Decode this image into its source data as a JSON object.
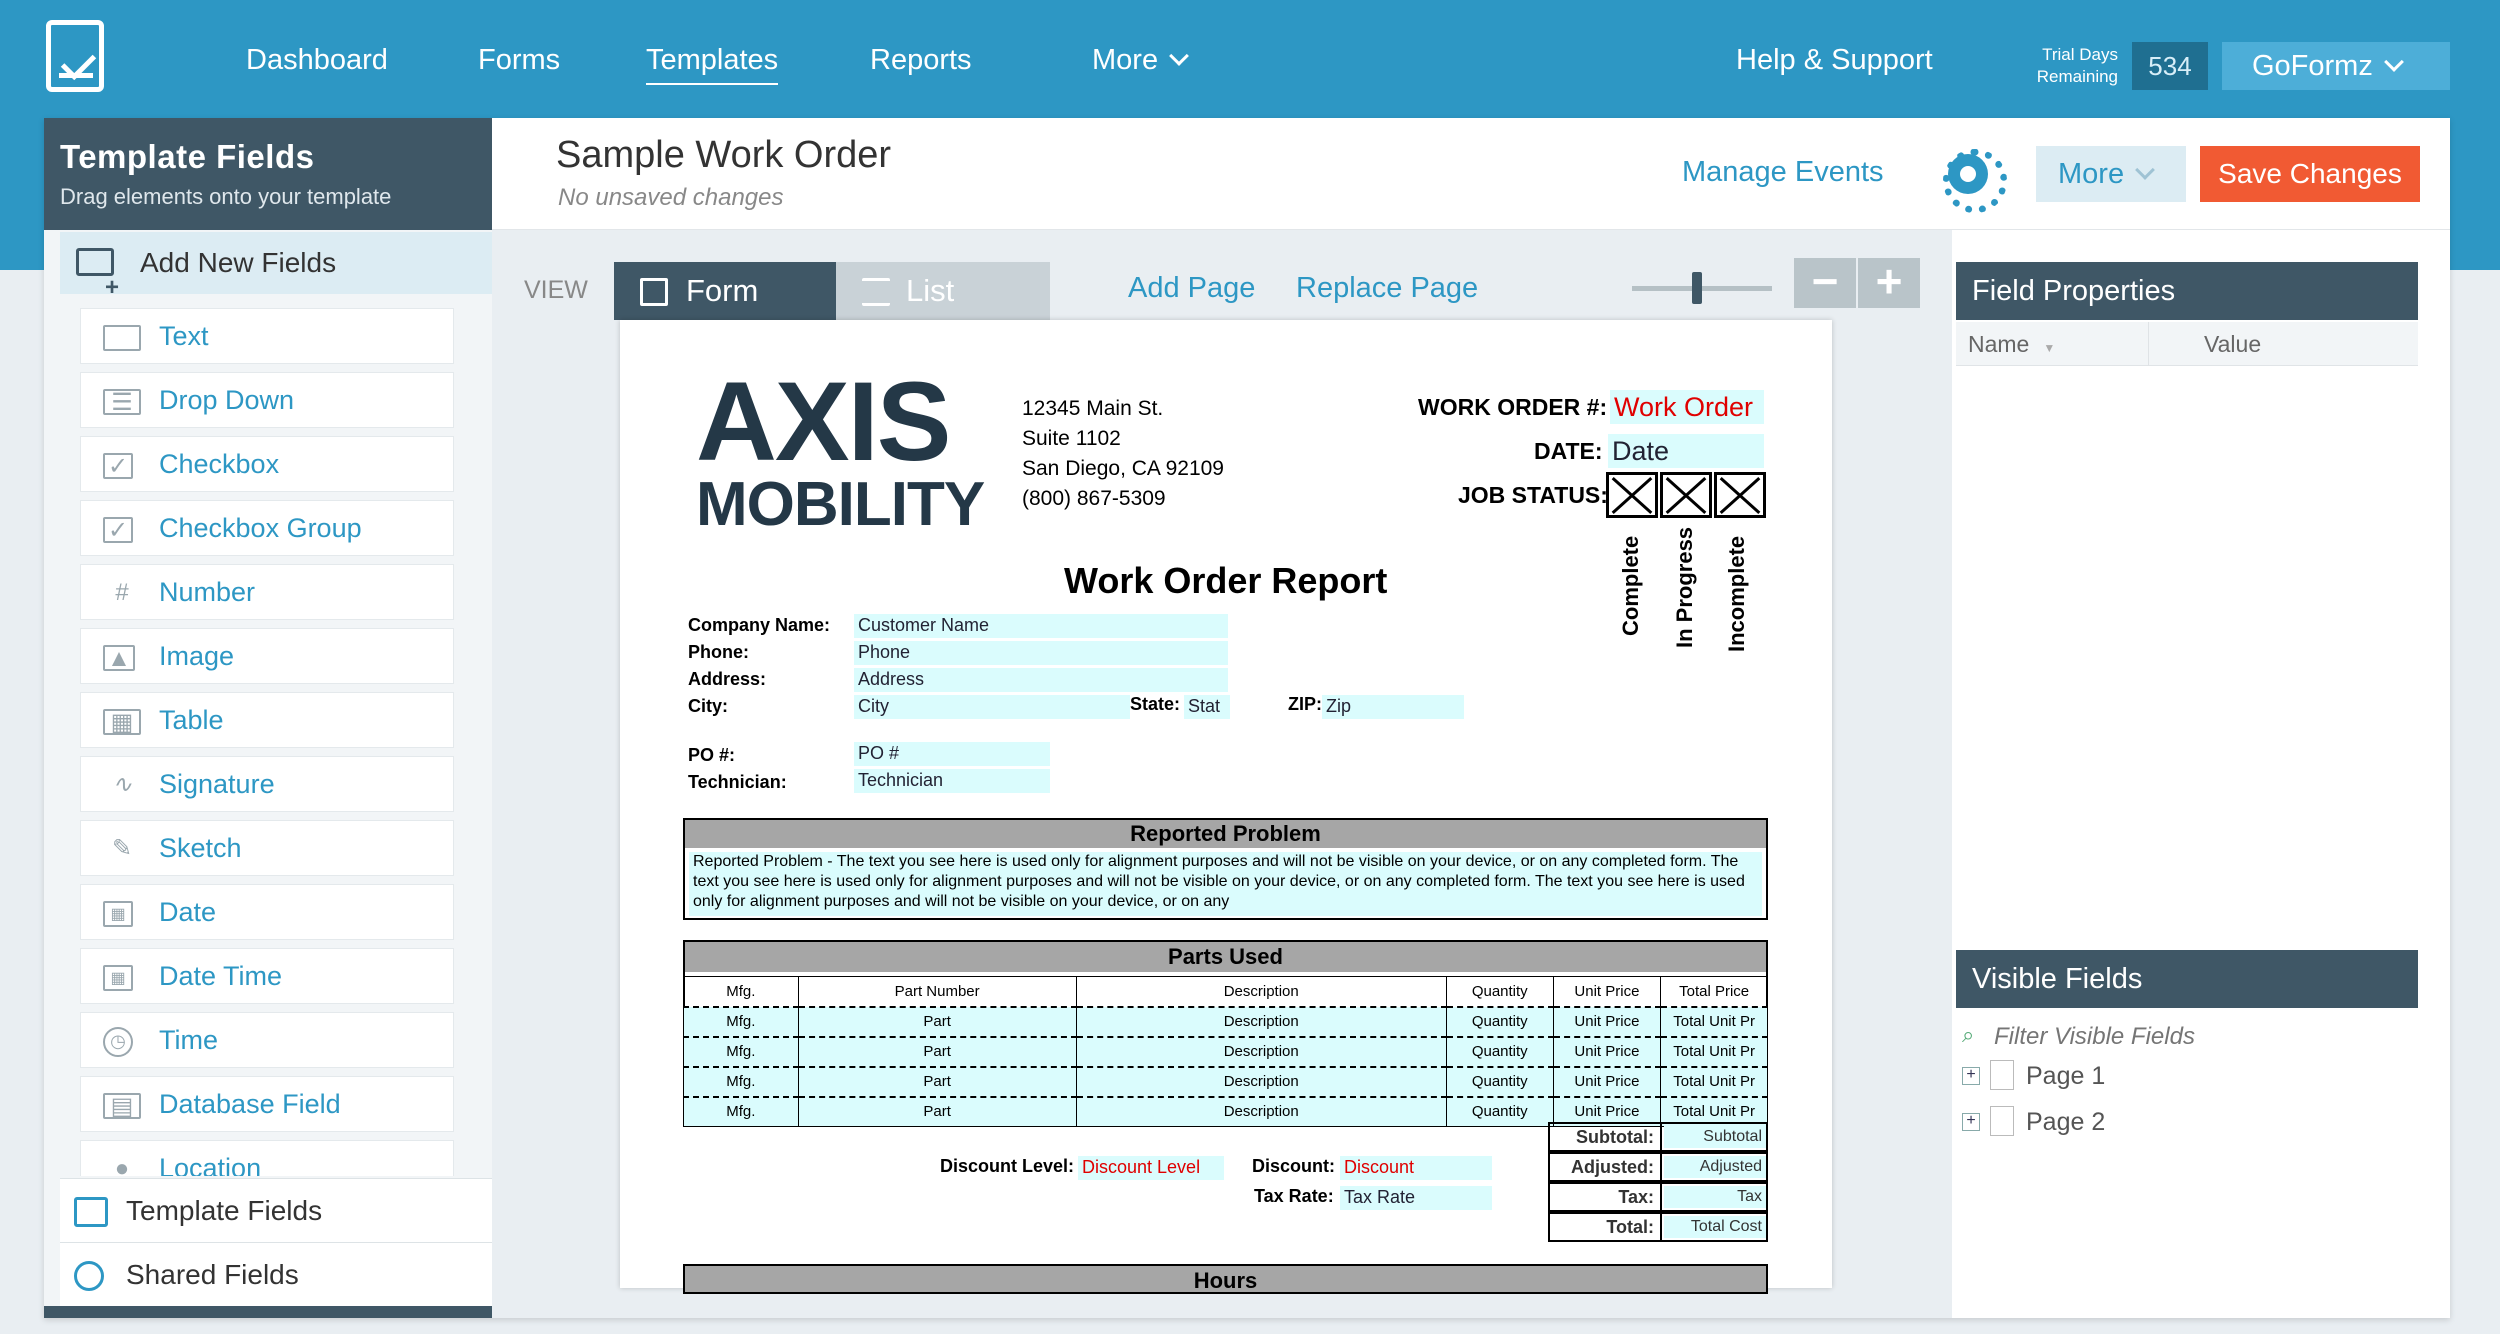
{
  "nav": {
    "dashboard": "Dashboard",
    "forms": "Forms",
    "templates": "Templates",
    "reports": "Reports",
    "more": "More",
    "help": "Help & Support",
    "trial_label_1": "Trial Days",
    "trial_label_2": "Remaining",
    "trial_days": "534",
    "account": "GoFormz"
  },
  "sidebar": {
    "title": "Template Fields",
    "subtitle": "Drag elements onto your template",
    "add_new": "Add New Fields",
    "items": [
      {
        "label": "Text",
        "icon": "text-field-icon"
      },
      {
        "label": "Drop Down",
        "icon": "dropdown-icon"
      },
      {
        "label": "Checkbox",
        "icon": "checkbox-icon"
      },
      {
        "label": "Checkbox Group",
        "icon": "checkbox-group-icon"
      },
      {
        "label": "Number",
        "icon": "hash-icon"
      },
      {
        "label": "Image",
        "icon": "image-icon"
      },
      {
        "label": "Table",
        "icon": "table-icon"
      },
      {
        "label": "Signature",
        "icon": "signature-icon"
      },
      {
        "label": "Sketch",
        "icon": "pencil-icon"
      },
      {
        "label": "Date",
        "icon": "calendar-icon"
      },
      {
        "label": "Date Time",
        "icon": "calendar-clock-icon"
      },
      {
        "label": "Time",
        "icon": "clock-icon"
      },
      {
        "label": "Database Field",
        "icon": "database-icon"
      },
      {
        "label": "Location",
        "icon": "location-pin-icon"
      }
    ],
    "template_fields": "Template Fields",
    "shared_fields": "Shared Fields"
  },
  "header": {
    "doc_title": "Sample Work Order",
    "doc_status": "No unsaved changes",
    "manage_events": "Manage Events",
    "more": "More",
    "save": "Save Changes"
  },
  "toolbar": {
    "view_label": "VIEW",
    "tab_form": "Form",
    "tab_list": "List",
    "add_page": "Add Page",
    "replace_page": "Replace Page",
    "zoom_out": "−",
    "zoom_in": "+"
  },
  "document": {
    "logo_axis": "AXIS",
    "logo_mobility": "MOBILITY",
    "address_1": "12345 Main St.",
    "address_2": "Suite 1102",
    "address_3": "San Diego, CA 92109",
    "phone": "(800) 867-5309",
    "work_order_label": "WORK ORDER #:",
    "work_order_value": "Work Order",
    "date_label": "DATE:",
    "date_value": "Date",
    "job_status_label": "JOB STATUS:",
    "status_complete": "Complete",
    "status_in_progress": "In Progress",
    "status_incomplete": "Incomplete",
    "report_title": "Work Order Report",
    "company_label": "Company Name:",
    "company_value": "Customer Name",
    "phone_label": "Phone:",
    "phone_value": "Phone",
    "address_label": "Address:",
    "address_value": "Address",
    "city_label": "City:",
    "city_value": "City",
    "state_label": "State:",
    "state_value": "Stat",
    "zip_label": "ZIP:",
    "zip_value": "Zip",
    "po_label": "PO #:",
    "po_value": "PO #",
    "tech_label": "Technician:",
    "tech_value": "Technician",
    "reported_problem_title": "Reported Problem",
    "reported_problem_text": "Reported Problem - The text you see here is used only for alignment purposes and will not be visible on your device, or on any completed form. The text you see here is used only for alignment purposes and will not be visible on your device, or on any completed form. The text you see here is used only for alignment purposes and will not be visible on your device, or on any",
    "parts_title": "Parts Used",
    "parts_headers": [
      "Mfg.",
      "Part Number",
      "Description",
      "Quantity",
      "Unit Price",
      "Total Price"
    ],
    "parts_row": [
      "Mfg.",
      "Part",
      "Description",
      "Quantity",
      "Unit Price",
      "Total Unit Pr"
    ],
    "discount_level_label": "Discount Level:",
    "discount_level_value": "Discount Level",
    "discount_label": "Discount:",
    "discount_value": "Discount",
    "tax_rate_label": "Tax Rate:",
    "tax_rate_value": "Tax Rate",
    "subtotal_label": "Subtotal:",
    "subtotal_value": "Subtotal",
    "adjusted_label": "Adjusted:",
    "adjusted_value": "Adjusted",
    "tax_label": "Tax:",
    "tax_value": "Tax",
    "total_label": "Total:",
    "total_value": "Total Cost",
    "hours_title": "Hours"
  },
  "field_properties": {
    "title": "Field Properties",
    "col_name": "Name",
    "col_value": "Value"
  },
  "visible_fields": {
    "title": "Visible Fields",
    "filter_placeholder": "Filter Visible Fields",
    "pages": [
      "Page 1",
      "Page 2"
    ]
  },
  "colors": {
    "brand": "#2d97c4",
    "header_dark": "#3f5766",
    "save": "#f15a33",
    "field_fill": "#dafcfd"
  }
}
